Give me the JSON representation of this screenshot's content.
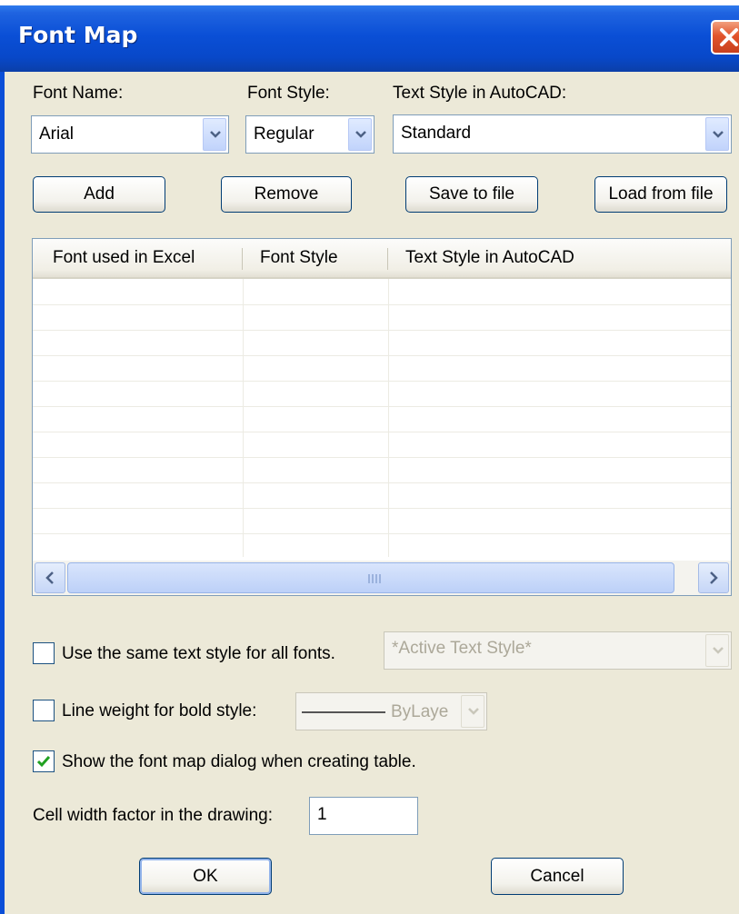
{
  "window": {
    "title": "Font Map"
  },
  "font_name": {
    "label": "Font Name:",
    "value": "Arial"
  },
  "font_style": {
    "label": "Font Style:",
    "value": "Regular"
  },
  "text_style": {
    "label": "Text Style in AutoCAD:",
    "value": "Standard"
  },
  "buttons": {
    "add": "Add",
    "remove": "Remove",
    "save": "Save to file",
    "load": "Load from file",
    "ok": "OK",
    "cancel": "Cancel"
  },
  "table": {
    "columns": [
      "Font used in Excel",
      "Font Style",
      "Text Style in AutoCAD"
    ],
    "rows": []
  },
  "options": {
    "same_style": {
      "label": "Use the same text style for all fonts.",
      "checked": false,
      "combo_value": "*Active Text Style*"
    },
    "line_weight": {
      "label": "Line weight for bold style:",
      "checked": false,
      "combo_value": "ByLaye"
    },
    "show_dialog": {
      "label": "Show the font map dialog when creating table.",
      "checked": true
    }
  },
  "cell_width": {
    "label": "Cell width factor in the drawing:",
    "value": "1"
  },
  "colors": {
    "titlebar": "#0a4fd6",
    "dialog_bg": "#ece9d8",
    "checkmark": "#21a121",
    "close_button": "#e2542c"
  },
  "icons": [
    "close-icon",
    "chevron-down-icon",
    "arrow-left-icon",
    "arrow-right-icon",
    "checkmark-icon"
  ]
}
